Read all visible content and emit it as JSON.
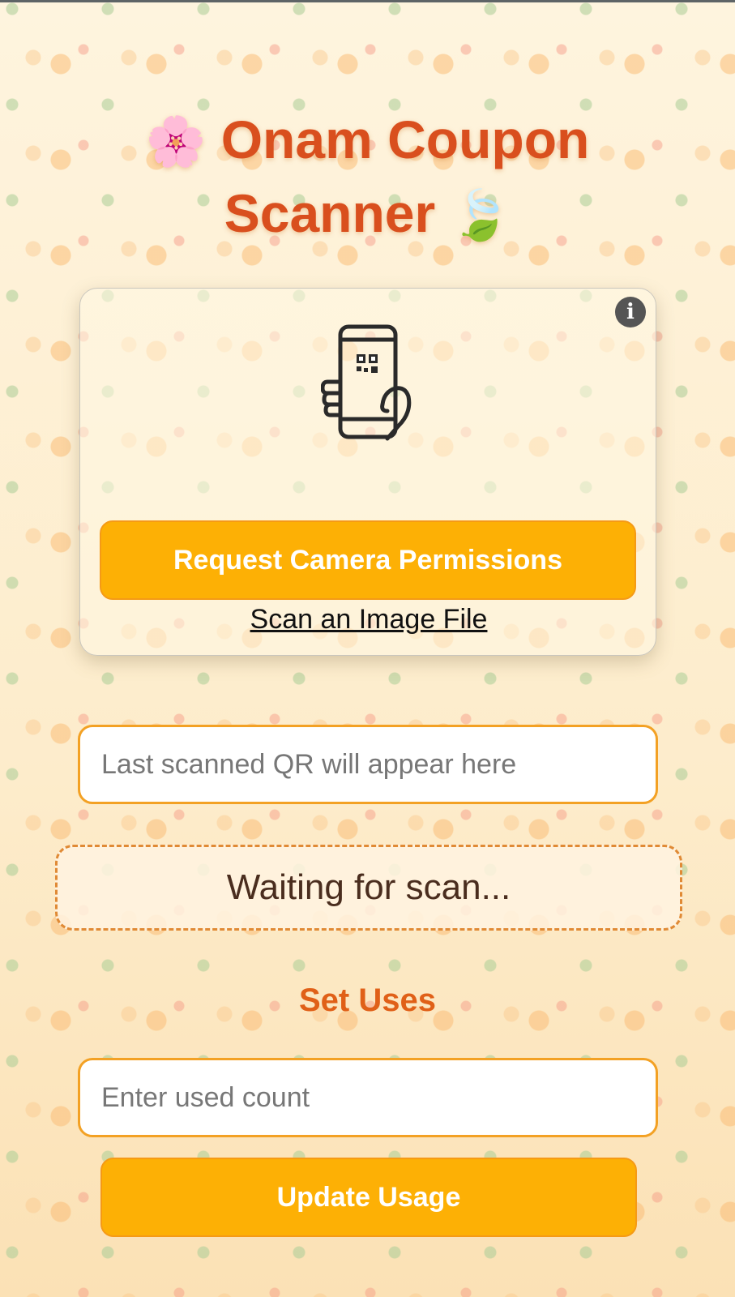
{
  "header": {
    "title_line1_emoji": "🌸",
    "title_line1_text": "Onam Coupon",
    "title_line2_text": "Scanner",
    "title_line2_emoji": "🍃"
  },
  "scanner_card": {
    "info_icon": "info-icon",
    "illustration_icon": "phone-scan-qr-icon",
    "request_camera_label": "Request Camera Permissions",
    "scan_file_label": "Scan an Image File"
  },
  "last_scanned": {
    "placeholder": "Last scanned QR will appear here"
  },
  "status": {
    "text": "Waiting for scan..."
  },
  "usage": {
    "heading": "Set Uses",
    "input_placeholder": "Enter used count",
    "update_label": "Update Usage"
  },
  "colors": {
    "title": "#d94f1e",
    "button_bg": "#fdb005",
    "button_border": "#f59a16",
    "heading": "#e06018",
    "field_border": "#f3a124",
    "status_border": "#e08a35"
  }
}
